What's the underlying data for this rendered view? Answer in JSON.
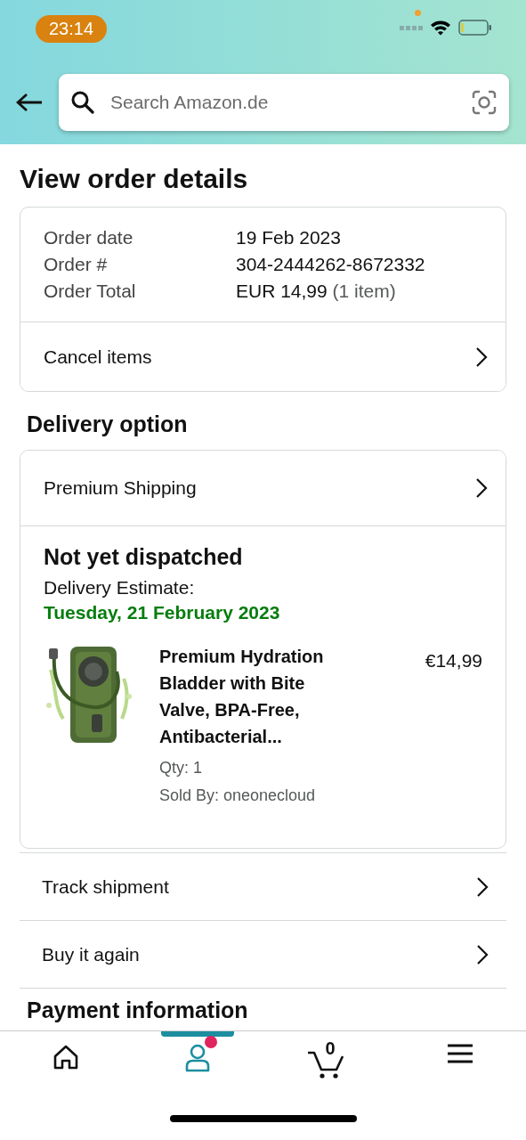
{
  "status_bar": {
    "time": "23:14"
  },
  "search": {
    "placeholder": "Search Amazon.de"
  },
  "title": "View order details",
  "order_summary": {
    "rows": [
      {
        "label": "Order date",
        "value": "19 Feb 2023"
      },
      {
        "label": "Order #",
        "value": "304-2444262-8672332"
      },
      {
        "label": "Order Total",
        "value": "EUR 14,99",
        "note": "(1 item)"
      }
    ],
    "action": "Cancel items"
  },
  "delivery": {
    "heading": "Delivery option",
    "option": "Premium Shipping",
    "status": "Not yet dispatched",
    "estimate_label": "Delivery Estimate:",
    "estimate_date": "Tuesday, 21 February 2023",
    "item": {
      "title": "Premium Hydration Bladder with Bite Valve, BPA-Free, Antibacterial...",
      "price": "€14,99",
      "qty": "Qty: 1",
      "seller": "Sold By: oneonecloud"
    }
  },
  "actions": [
    "Track shipment",
    "Buy it again"
  ],
  "payment_heading": "Payment information",
  "nav": [
    {
      "kind": "home",
      "selected": false
    },
    {
      "kind": "account",
      "selected": true,
      "badge": true
    },
    {
      "kind": "cart",
      "selected": false,
      "count": "0"
    },
    {
      "kind": "menu",
      "selected": false
    }
  ]
}
